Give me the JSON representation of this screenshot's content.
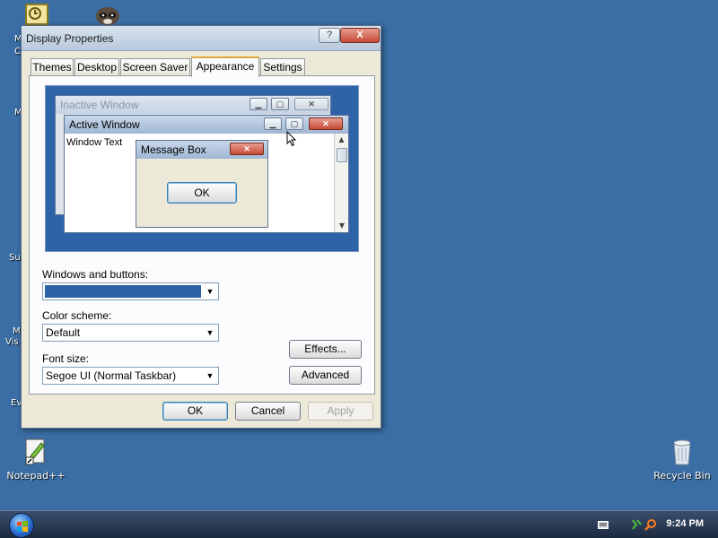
{
  "desktop": {
    "icons": [
      {
        "name": "notepadpp-icon",
        "label": "Notepad++"
      },
      {
        "name": "recycle-bin-icon",
        "label": "Recycle Bin"
      }
    ],
    "side_labels": [
      "M",
      "C",
      "M",
      "Su",
      "M",
      "Vis",
      "Ev"
    ]
  },
  "taskbar": {
    "clock": "9:24 PM"
  },
  "dialog": {
    "title": "Display Properties",
    "help_label": "?",
    "close_label": "X",
    "tabs": [
      "Themes",
      "Desktop",
      "Screen Saver",
      "Appearance",
      "Settings"
    ],
    "active_tab": "Appearance",
    "preview": {
      "inactive_window_title": "Inactive Window",
      "active_window_title": "Active Window",
      "window_text": "Window Text",
      "message_box_title": "Message Box",
      "ok_label": "OK"
    },
    "windows_and_buttons": {
      "label": "Windows and buttons:",
      "value": ""
    },
    "color_scheme": {
      "label": "Color scheme:",
      "value": "Default"
    },
    "font_size": {
      "label": "Font size:",
      "value": "Segoe UI (Normal Taskbar)"
    },
    "effects_label": "Effects...",
    "advanced_label": "Advanced",
    "ok_label": "OK",
    "cancel_label": "Cancel",
    "apply_label": "Apply"
  },
  "colors": {
    "desktop": "#3a6ea5",
    "dialog_bg": "#ece9d8",
    "selection": "#2f63a8",
    "close_button": "#c44a34"
  }
}
